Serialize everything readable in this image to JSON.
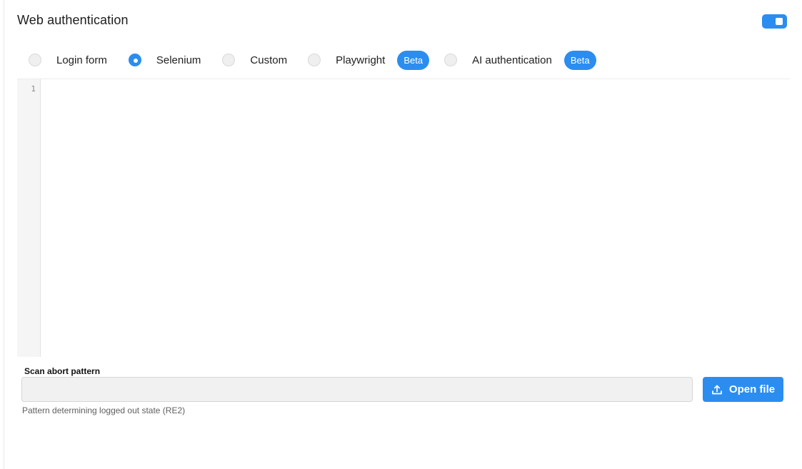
{
  "section": {
    "title": "Web authentication",
    "enabled": true
  },
  "auth_methods": [
    {
      "label": "Login form",
      "selected": false,
      "badge": ""
    },
    {
      "label": "Selenium",
      "selected": true,
      "badge": ""
    },
    {
      "label": "Custom",
      "selected": false,
      "badge": ""
    },
    {
      "label": "Playwright",
      "selected": false,
      "badge": "Beta"
    },
    {
      "label": "AI authentication",
      "selected": false,
      "badge": "Beta"
    }
  ],
  "editor": {
    "line_numbers": [
      "1"
    ],
    "content": ""
  },
  "scan_abort": {
    "label": "Scan abort pattern",
    "value": "",
    "placeholder": "",
    "helper": "Pattern determining logged out state (RE2)"
  },
  "open_file": {
    "label": "Open file",
    "icon": "upload-icon"
  },
  "colors": {
    "accent": "#2b8df0"
  }
}
